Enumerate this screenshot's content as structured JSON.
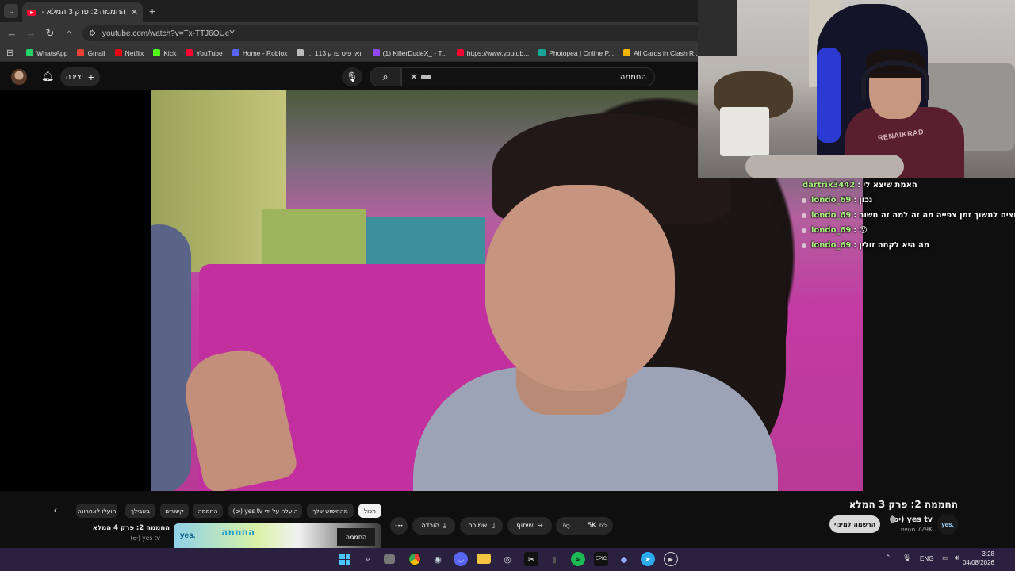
{
  "browser": {
    "tab_title": "החממה 2: פרק 3 המלא - YouTube",
    "new_tab": "+",
    "tab_close": "✕",
    "url": "youtube.com/watch?v=Tx-TTJ6OUeY",
    "bookmarks": [
      {
        "label": "WhatsApp",
        "color": "#25d366"
      },
      {
        "label": "Gmail",
        "color": "#ea4335"
      },
      {
        "label": "Netflix",
        "color": "#e50914"
      },
      {
        "label": "Kick",
        "color": "#53fc18"
      },
      {
        "label": "YouTube",
        "color": "#ff0033"
      },
      {
        "label": "Home - Roblox",
        "color": "#5865f2"
      },
      {
        "label": "... וואן פיס פרק 113",
        "color": "#bbbbbb"
      },
      {
        "label": "(1) KillerDudeX_ - T...",
        "color": "#9146ff"
      },
      {
        "label": "https://www.youtub...",
        "color": "#ff0033"
      },
      {
        "label": "Photopea | Online P...",
        "color": "#18a497"
      },
      {
        "label": "All Cards in Clash R...",
        "color": "#f5b400"
      }
    ]
  },
  "youtube": {
    "create_label": "יצירה",
    "search_value": "החממה",
    "video_title": "החממה 2: פרק 3 המלא",
    "channel_name": "yes tv (יס)",
    "channel_logo": "yes.",
    "subscribers": "729K מנויים",
    "subscribe_label": "הרשמה למינוי",
    "like_count": "5K",
    "share_label": "שיתוף",
    "save_label": "שמירה",
    "download_label": "הורדה",
    "more_label": "•••",
    "chips": [
      {
        "label": "הכול",
        "active": true
      },
      {
        "label": "מהחיפוש שלך",
        "active": false
      },
      {
        "label": "הועלה על ידי yes tv (יס)",
        "active": false
      },
      {
        "label": "החממה",
        "active": false
      },
      {
        "label": "קשורים",
        "active": false
      },
      {
        "label": "בשבילך",
        "active": false
      },
      {
        "label": "הועלו לאחרונה",
        "active": false
      }
    ],
    "suggested": {
      "title": "החממה 2: פרק 4 המלא",
      "channel": "yes tv (יס)",
      "thumb_brand": "yes.",
      "thumb_title": "החממה",
      "thumb_logo": "החממה"
    }
  },
  "webcam": {
    "shirt_text": "RENAIKRAD"
  },
  "chat": [
    {
      "user": "dartrix3442",
      "message": "האמת שיצא לי",
      "dot": false
    },
    {
      "user": "londo_69",
      "message": "נכון",
      "dot": true
    },
    {
      "user": "londo_69",
      "message": "אם רוצים למשוך זמן צפייה מה זה למה זה חשוב",
      "dot": true
    },
    {
      "user": "londo_69",
      "message": "😯",
      "dot": true
    },
    {
      "user": "londo_69",
      "message": "מה היא לקחה זולין",
      "dot": true
    }
  ],
  "taskbar": {
    "lang": "ENG",
    "time": "3:28",
    "date": "04/08/2026"
  }
}
